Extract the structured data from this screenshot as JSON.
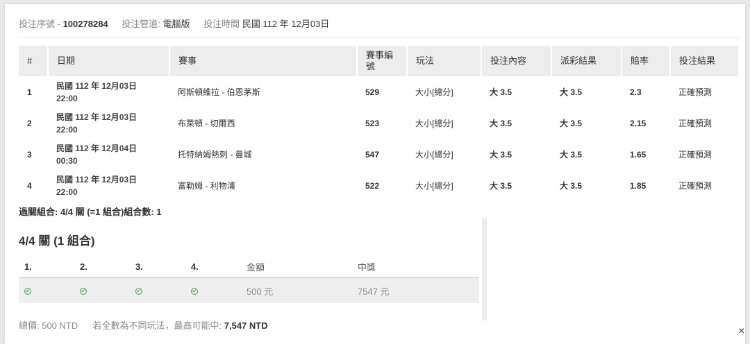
{
  "meta": {
    "serial_label": "投注序號 -",
    "serial_value": "100278284",
    "channel_label": "投注管道:",
    "channel_value": "電腦版",
    "time_label": "投注時間",
    "time_value": "民國 112 年 12月03日"
  },
  "table": {
    "headers": [
      "#",
      "日期",
      "賽事",
      "賽事編號",
      "玩法",
      "投注內容",
      "派彩結果",
      "賠率",
      "投注結果"
    ],
    "rows": [
      {
        "idx": "1",
        "date_line1": "民國 112 年 12月03日",
        "date_line2": "22:00",
        "match": "阿斯頓維拉 - 伯恩茅斯",
        "match_no": "529",
        "play": "大小[總分]",
        "bet": "大 3.5",
        "result": "大 3.5",
        "odds": "2.3",
        "outcome": "正確預測"
      },
      {
        "idx": "2",
        "date_line1": "民國 112 年 12月03日",
        "date_line2": "22:00",
        "match": "布萊頓 - 切爾西",
        "match_no": "523",
        "play": "大小[總分]",
        "bet": "大 3.5",
        "result": "大 3.5",
        "odds": "2.15",
        "outcome": "正確預測"
      },
      {
        "idx": "3",
        "date_line1": "民國 112 年 12月04日",
        "date_line2": "00:30",
        "match": "托特納姆熱刺 - 曼城",
        "match_no": "547",
        "play": "大小[總分]",
        "bet": "大 3.5",
        "result": "大 3.5",
        "odds": "1.65",
        "outcome": "正確預測"
      },
      {
        "idx": "4",
        "date_line1": "民國 112 年 12月03日",
        "date_line2": "22:00",
        "match": "富勒姆 - 利物浦",
        "match_no": "522",
        "play": "大小[總分]",
        "bet": "大 3.5",
        "result": "大 3.5",
        "odds": "1.85",
        "outcome": "正確預測"
      }
    ]
  },
  "combo_summary": "過關組合: 4/4 關 (=1 組合)組合數: 1",
  "combo": {
    "title": "4/4 關 (1 組合)",
    "headers": [
      "1.",
      "2.",
      "3.",
      "4.",
      "金額",
      "中獎"
    ],
    "amount": "500 元",
    "win": "7547 元",
    "icon": "check-circle-icon",
    "check_color": "#3aa04a"
  },
  "footer": {
    "total_label": "總價: 500 NTD",
    "note": "若全數為不同玩法，最高可能中:",
    "max_win": "7,547 NTD"
  },
  "close": {
    "symbol": "×"
  }
}
